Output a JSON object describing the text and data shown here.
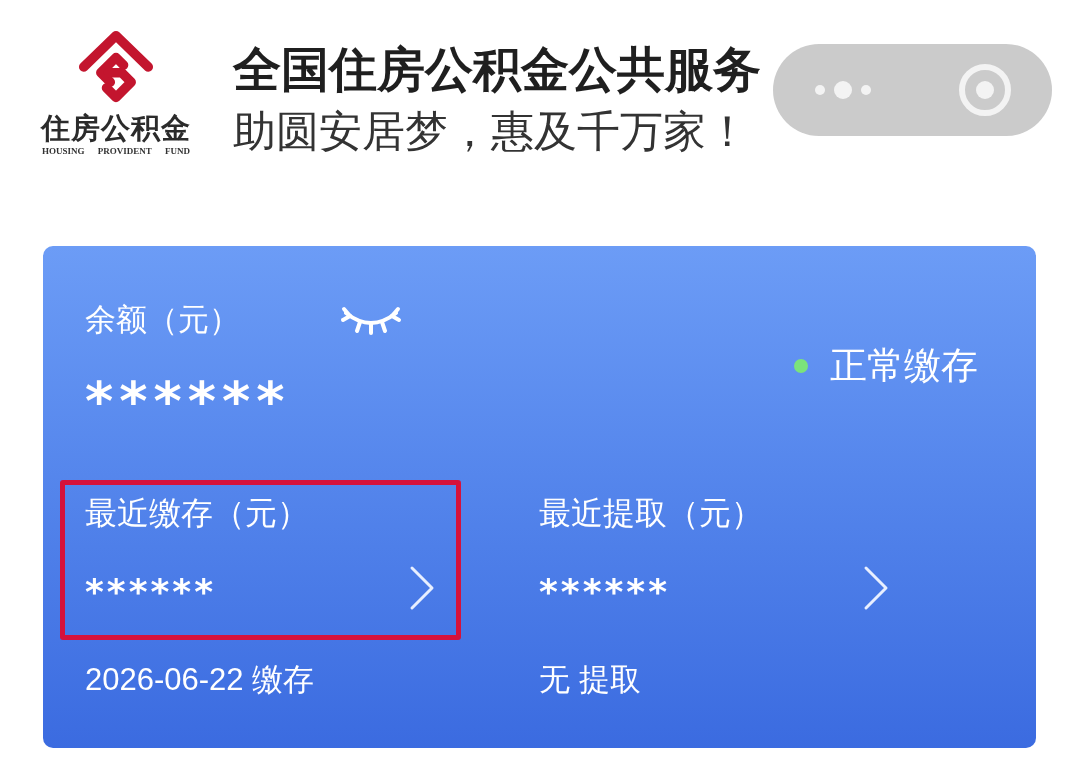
{
  "header": {
    "logo": {
      "name": "住房公积金",
      "subtitle": "HOUSING PROVIDENT FUND"
    },
    "title": "全国住房公积金公共服务",
    "slogan": "助圆安居梦，惠及千万家！"
  },
  "card": {
    "balance": {
      "label": "余额（元）",
      "value": "******",
      "hidden": true
    },
    "status": {
      "label": "正常缴存",
      "color": "#7be37b"
    },
    "records": [
      {
        "label": "最近缴存（元）",
        "value": "******",
        "note": "2026-06-22 缴存",
        "highlighted": true
      },
      {
        "label": "最近提取（元）",
        "value": "******",
        "note": "无 提取",
        "highlighted": false
      }
    ]
  }
}
